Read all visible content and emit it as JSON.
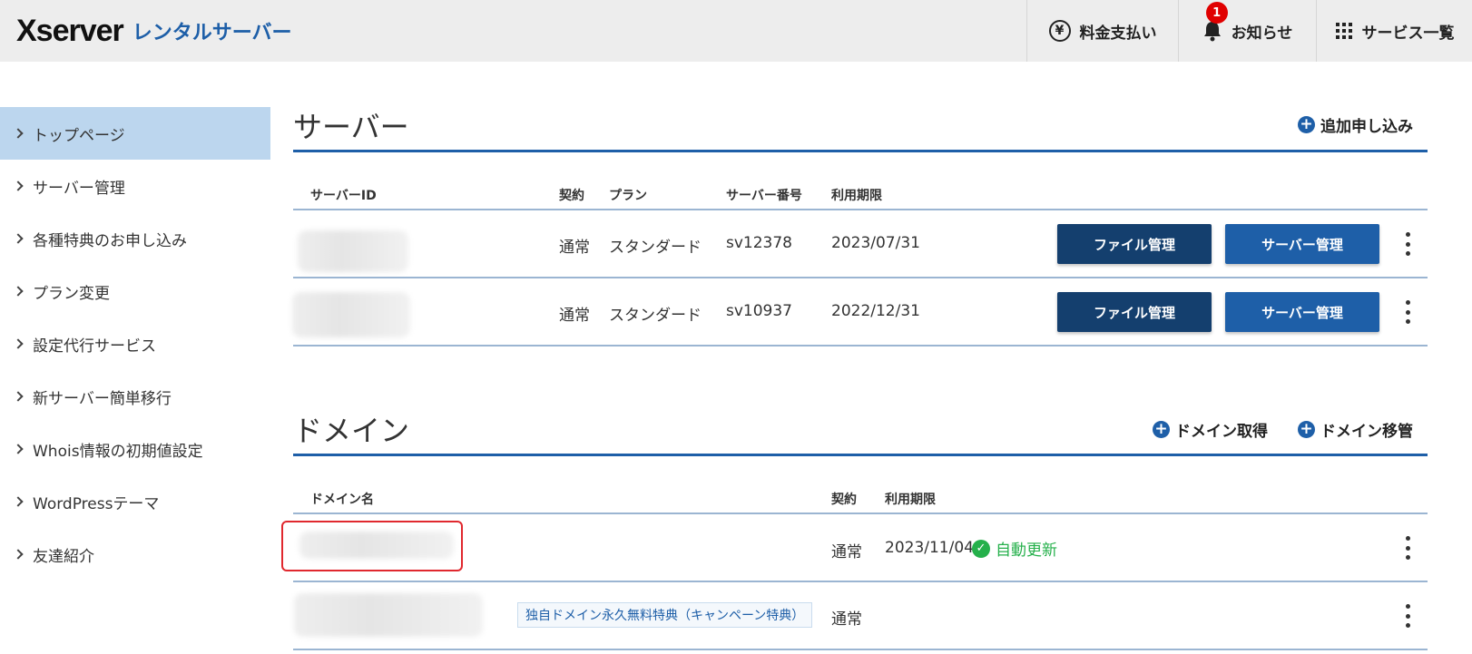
{
  "header": {
    "logo_main": "Xserver",
    "logo_sub": "レンタルサーバー",
    "nav": {
      "payment": "料金支払い",
      "notifications": "お知らせ",
      "notification_count": "1",
      "services": "サービス一覧"
    }
  },
  "sidebar": {
    "items": [
      {
        "label": "トップページ",
        "active": true
      },
      {
        "label": "サーバー管理"
      },
      {
        "label": "各種特典のお申し込み"
      },
      {
        "label": "プラン変更"
      },
      {
        "label": "設定代行サービス"
      },
      {
        "label": "新サーバー簡単移行"
      },
      {
        "label": "Whois情報の初期値設定"
      },
      {
        "label": "WordPressテーマ"
      },
      {
        "label": "友達紹介"
      }
    ]
  },
  "server": {
    "title": "サーバー",
    "add_label": "追加申し込み",
    "columns": {
      "id": "サーバーID",
      "contract": "契約",
      "plan": "プラン",
      "number": "サーバー番号",
      "expiry": "利用期限"
    },
    "rows": [
      {
        "contract": "通常",
        "plan": "スタンダード",
        "number": "sv12378",
        "expiry": "2023/07/31",
        "file_btn": "ファイル管理",
        "server_btn": "サーバー管理"
      },
      {
        "contract": "通常",
        "plan": "スタンダード",
        "number": "sv10937",
        "expiry": "2022/12/31",
        "file_btn": "ファイル管理",
        "server_btn": "サーバー管理"
      }
    ]
  },
  "domain": {
    "title": "ドメイン",
    "acquire_label": "ドメイン取得",
    "transfer_label": "ドメイン移管",
    "columns": {
      "name": "ドメイン名",
      "contract": "契約",
      "expiry": "利用期限"
    },
    "rows": [
      {
        "contract": "通常",
        "expiry": "2023/11/04",
        "auto_renew": "自動更新"
      },
      {
        "campaign": "独自ドメイン永久無料特典（キャンペーン特典）",
        "contract": "通常"
      }
    ]
  },
  "colors": {
    "accent": "#1e5fa8",
    "dark_button": "#143f6e",
    "active_bg": "#bcd6ee",
    "success": "#25b04b",
    "alert": "#e00000"
  }
}
